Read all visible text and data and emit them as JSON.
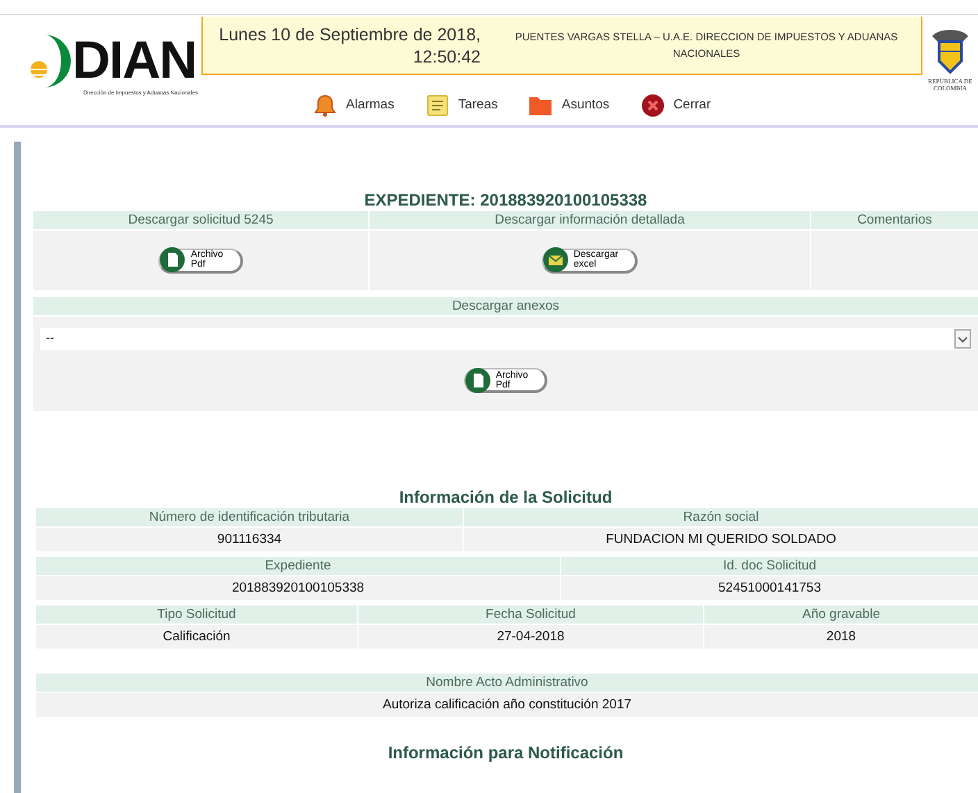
{
  "header": {
    "logo_text": "DIAN",
    "logo_subtitle": "Dirección de Impuestos y Aduanas Nacionales",
    "date": "Lunes 10 de Septiembre de 2018,",
    "time": "12:50:42",
    "user": "PUENTES VARGAS STELLA – U.A.E. DIRECCION DE IMPUESTOS Y ADUANAS NACIONALES",
    "nav": [
      {
        "label": "Alarmas",
        "kind": "bell"
      },
      {
        "label": "Tareas",
        "kind": "tasks"
      },
      {
        "label": "Asuntos",
        "kind": "folder"
      },
      {
        "label": "Cerrar",
        "kind": "close"
      }
    ],
    "emblem_caption": "REPÚBLICA DE COLOMBIA"
  },
  "expediente": {
    "title": "EXPEDIENTE: 201883920100105338",
    "downloads": [
      {
        "header": "Descargar solicitud 5245",
        "button": {
          "kind": "pdf",
          "line1": "Archivo",
          "line2": "Pdf"
        }
      },
      {
        "header": "Descargar información detallada",
        "button": {
          "kind": "excel",
          "line1": "Descargar",
          "line2": "excel"
        }
      },
      {
        "header": "Comentarios"
      }
    ],
    "anexos": {
      "header": "Descargar anexos",
      "select_value": "--",
      "button": {
        "kind": "pdf",
        "line1": "Archivo",
        "line2": "Pdf"
      }
    }
  },
  "solicitud": {
    "title": "Información de la Solicitud",
    "groups": [
      {
        "cells": [
          {
            "label": "Número de identificación tributaria",
            "value": "901116334"
          },
          {
            "label": "Razón social",
            "value": "FUNDACION MI QUERIDO SOLDADO"
          }
        ]
      },
      {
        "cells": [
          {
            "label": "Expediente",
            "value": "201883920100105338"
          },
          {
            "label": "Id. doc Solicitud",
            "value": "52451000141753"
          }
        ]
      },
      {
        "cells": [
          {
            "label": "Tipo Solicitud",
            "value": "Calificación"
          },
          {
            "label": "Fecha Solicitud",
            "value": "27-04-2018"
          },
          {
            "label": "Año gravable",
            "value": "2018"
          }
        ]
      },
      {
        "cells": [
          {
            "label": "Nombre Acto Administrativo",
            "value": "Autoriza calificación año constitución 2017"
          }
        ]
      }
    ]
  },
  "notificacion": {
    "title": "Información para Notificación"
  }
}
